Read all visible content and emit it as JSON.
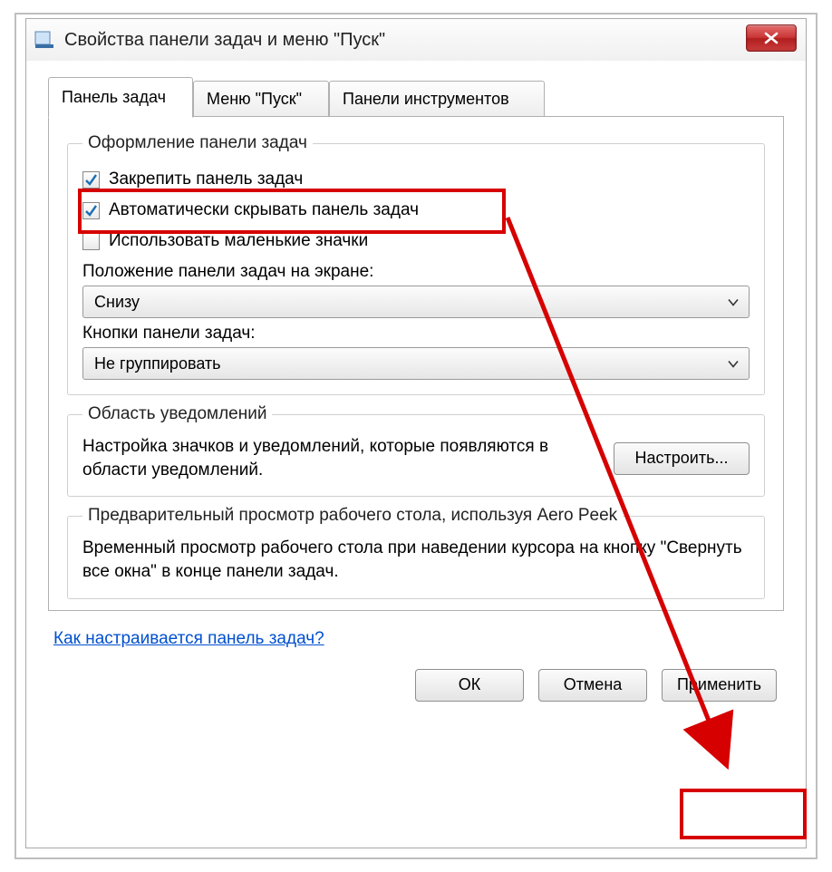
{
  "window": {
    "title": "Свойства панели задач и меню \"Пуск\""
  },
  "tabs": [
    {
      "label": "Панель задач",
      "active": true
    },
    {
      "label": "Меню \"Пуск\"",
      "active": false
    },
    {
      "label": "Панели инструментов",
      "active": false
    }
  ],
  "groupbox_appearance": {
    "legend": "Оформление панели задач",
    "checkboxes": {
      "lock": {
        "label": "Закрепить панель задач",
        "checked": true
      },
      "autohide": {
        "label": "Автоматически скрывать панель задач",
        "checked": true
      },
      "small": {
        "label": "Использовать маленькие значки",
        "checked": false
      }
    },
    "position_label": "Положение панели задач на экране:",
    "position_value": "Снизу",
    "buttons_label": "Кнопки панели задач:",
    "buttons_value": "Не группировать"
  },
  "groupbox_notifications": {
    "legend": "Область уведомлений",
    "text": "Настройка значков и уведомлений, которые появляются в области уведомлений.",
    "button": "Настроить..."
  },
  "groupbox_aeropeek": {
    "legend": "Предварительный просмотр рабочего стола, используя Aero Peek",
    "text": "Временный просмотр рабочего стола при наведении курсора на кнопку \"Свернуть все окна\" в конце панели задач."
  },
  "help_link": "Как настраивается панель задач?",
  "buttons": {
    "ok": "ОК",
    "cancel": "Отмена",
    "apply": "Применить"
  }
}
